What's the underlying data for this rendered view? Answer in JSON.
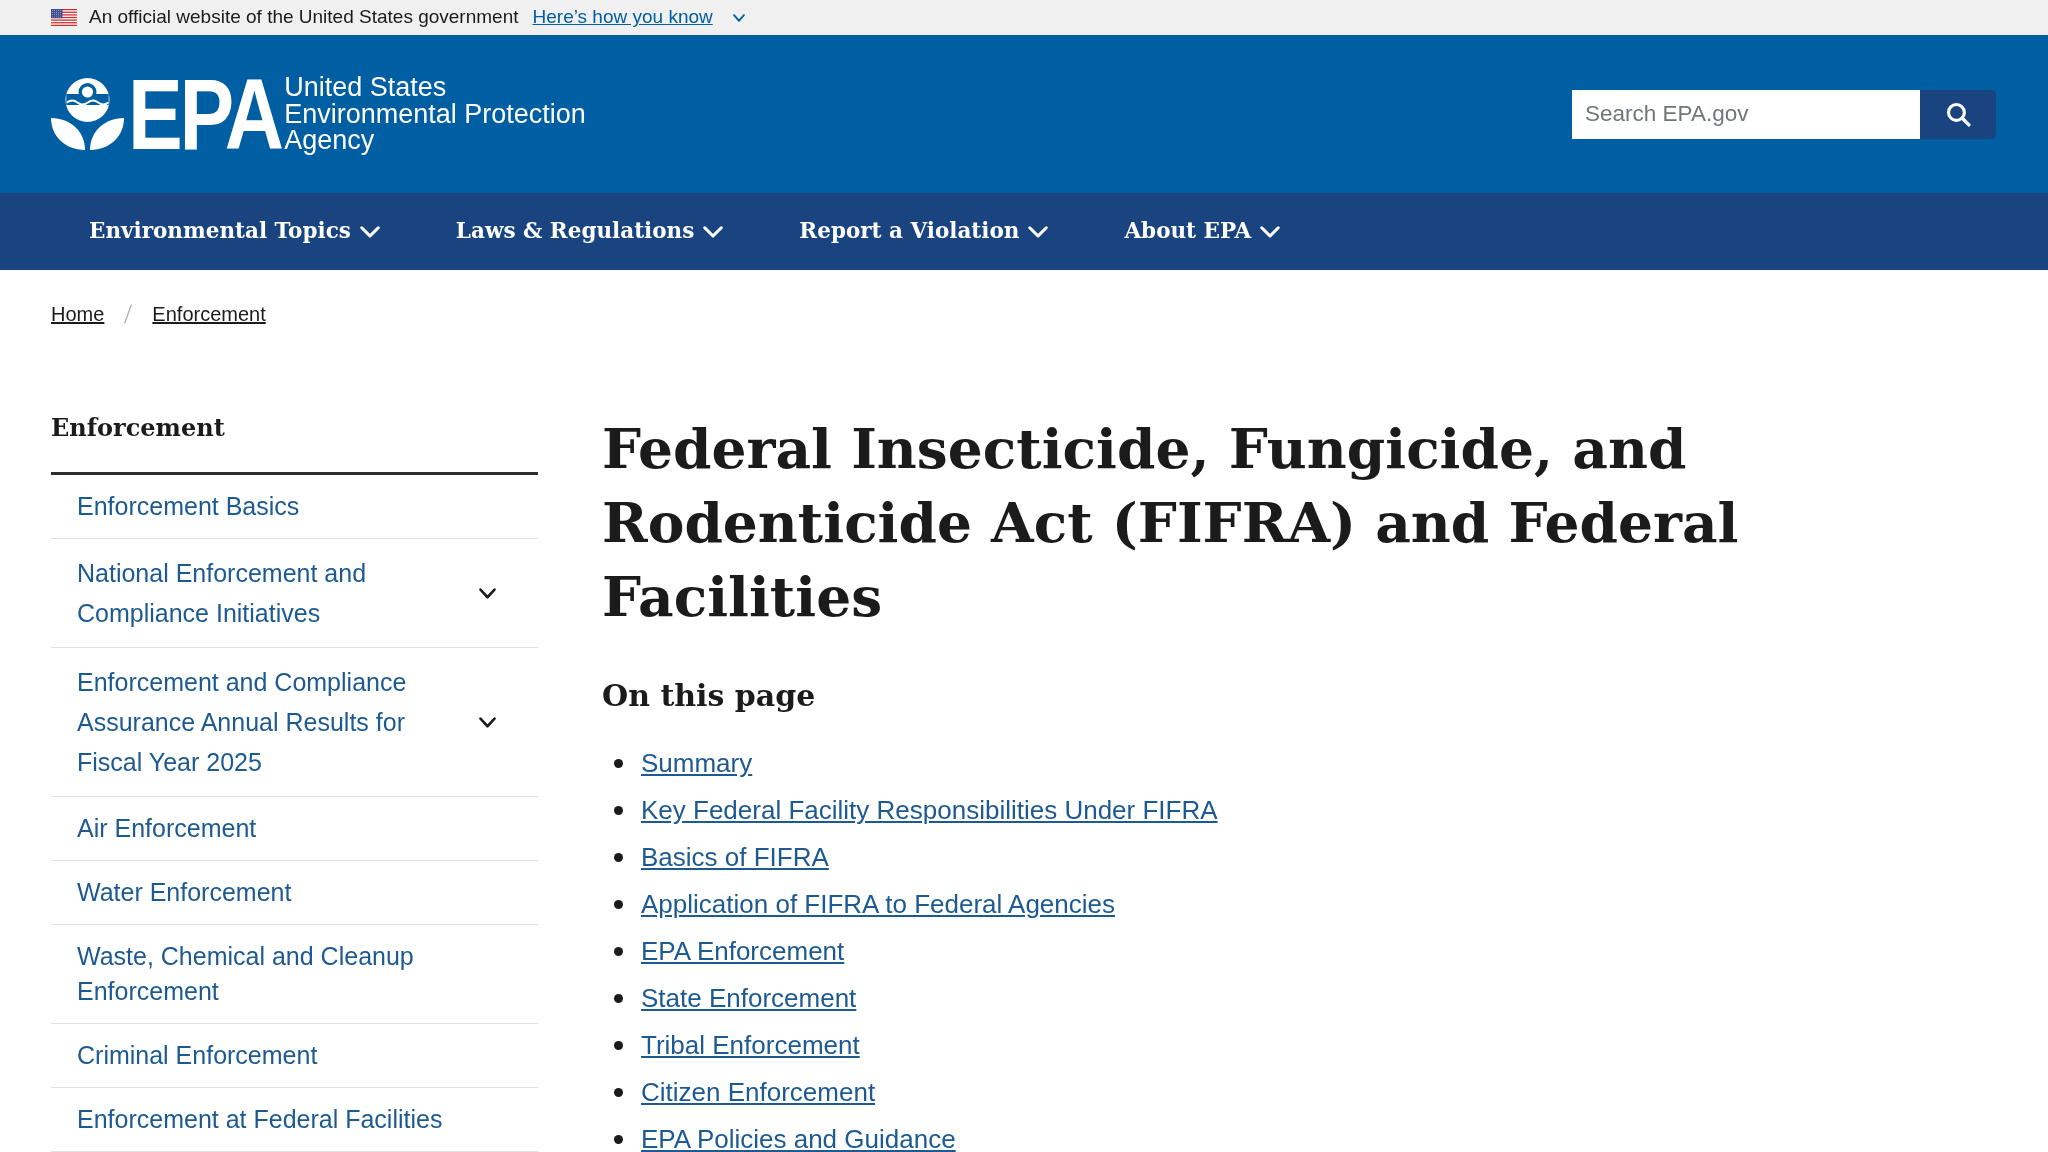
{
  "gov_banner": {
    "text": "An official website of the United States government",
    "link": "Here’s how you know",
    "expanded": false
  },
  "header": {
    "logo": {
      "wordmark": "EPA",
      "agency_name": [
        "United States",
        "Environmental Protection",
        "Agency"
      ]
    },
    "search": {
      "placeholder": "Search EPA.gov"
    }
  },
  "nav": {
    "items": [
      {
        "label": "Environmental Topics",
        "expanded": false
      },
      {
        "label": "Laws & Regulations",
        "expanded": false
      },
      {
        "label": "Report a Violation",
        "expanded": false
      },
      {
        "label": "About EPA",
        "expanded": false
      }
    ]
  },
  "breadcrumb": [
    "Home",
    "Enforcement"
  ],
  "sidebar": {
    "title": "Enforcement",
    "items": [
      {
        "kind": "link",
        "label": "Enforcement Basics"
      },
      {
        "kind": "group",
        "label": "National Enforcement and Compliance Initiatives",
        "expanded": false
      },
      {
        "kind": "group",
        "label": "Enforcement and Compliance Assurance Annual Results for Fiscal Year 2025",
        "expanded": false
      },
      {
        "kind": "link",
        "label": "Air Enforcement"
      },
      {
        "kind": "link",
        "label": "Water Enforcement"
      },
      {
        "kind": "link",
        "label": "Waste, Chemical and Cleanup Enforcement"
      },
      {
        "kind": "link",
        "label": "Criminal Enforcement"
      },
      {
        "kind": "link",
        "label": "Enforcement at Federal Facilities"
      }
    ]
  },
  "main": {
    "title": "Federal Insecticide, Fungicide, and Rodenticide Act (FIFRA) and Federal Facilities",
    "toc": {
      "heading": "On this page",
      "links": [
        "Summary",
        "Key Federal Facility Responsibilities Under FIFRA",
        "Basics of FIFRA",
        "Application of FIFRA to Federal Agencies",
        "EPA Enforcement",
        "State Enforcement",
        "Tribal Enforcement",
        "Citizen Enforcement",
        "EPA Policies and Guidance"
      ]
    }
  }
}
